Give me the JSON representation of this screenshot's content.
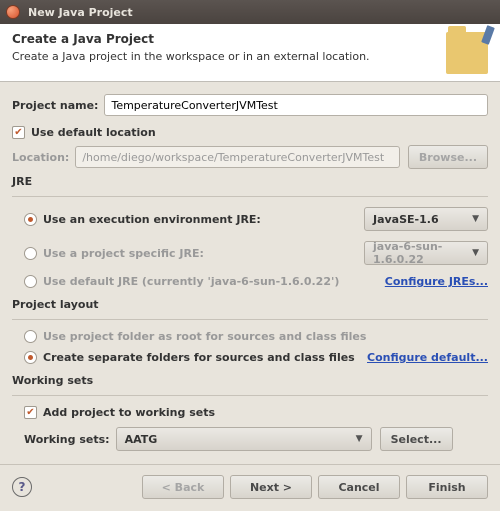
{
  "window": {
    "title": "New Java Project"
  },
  "banner": {
    "heading": "Create a Java Project",
    "sub": "Create a Java project in the workspace or in an external location."
  },
  "projectName": {
    "label": "Project name:",
    "value": "TemperatureConverterJVMTest"
  },
  "useDefaultLocation": {
    "label": "Use default location",
    "checked": true
  },
  "location": {
    "label": "Location:",
    "value": "/home/diego/workspace/TemperatureConverterJVMTest",
    "browse": "Browse..."
  },
  "jre": {
    "title": "JRE",
    "execEnv": {
      "label": "Use an execution environment JRE:",
      "value": "JavaSE-1.6"
    },
    "projectSpecific": {
      "label": "Use a project specific JRE:",
      "value": "java-6-sun-1.6.0.22"
    },
    "defaultJre": {
      "label": "Use default JRE (currently 'java-6-sun-1.6.0.22')"
    },
    "configureLink": "Configure JREs..."
  },
  "layout": {
    "title": "Project layout",
    "root": "Use project folder as root for sources and class files",
    "separate": "Create separate folders for sources and class files",
    "configureLink": "Configure default..."
  },
  "workingSets": {
    "title": "Working sets",
    "addLabel": "Add project to working sets",
    "label": "Working sets:",
    "value": "AATG",
    "selectBtn": "Select..."
  },
  "footer": {
    "back": "< Back",
    "next": "Next >",
    "cancel": "Cancel",
    "finish": "Finish"
  }
}
